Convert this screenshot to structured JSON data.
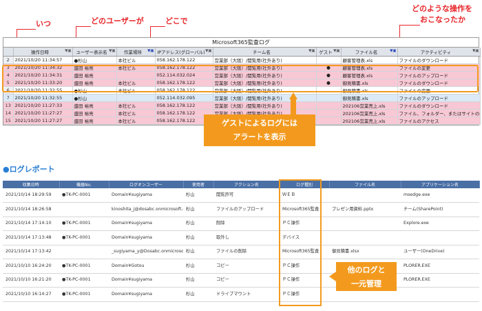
{
  "callouts": {
    "when": "いつ",
    "who": "どのユーザーが",
    "where": "どこで",
    "what_line1": "どのような操作を",
    "what_line2": "おこなったか"
  },
  "audit": {
    "title": "Microsoft365監査ログ",
    "columns": [
      "操作日時",
      "ユーザー表示名",
      "作業場所",
      "IPアドレス(グローバル)",
      "チーム名",
      "ゲスト",
      "ファイル名",
      "アクティビティ"
    ],
    "rows": [
      {
        "num": "2",
        "time": "2021/10/20 11:34:57",
        "user": "●杉山",
        "place": "本社ビル",
        "ip": "058.162.178.122",
        "team": "営業部（大阪）/閲覧用(社外あり)",
        "guest": "",
        "file": "顧客管理表.xls",
        "activity": "ファイルのダウンロード",
        "style": ""
      },
      {
        "num": "3",
        "time": "2021/10/20 11:34:32",
        "user": "盛田 裕亮",
        "place": "本社ビル",
        "ip": "058.162.178.122",
        "team": "営業部（大阪）/閲覧用(社外あり)",
        "guest": "●",
        "file": "顧客管理表.xls",
        "activity": "ファイルの変更",
        "style": "pink"
      },
      {
        "num": "4",
        "time": "2021/10/20 11:34:31",
        "user": "盛田 裕亮",
        "place": "",
        "ip": "052.114.032.024",
        "team": "営業部（大阪）/閲覧用(社外あり)",
        "guest": "●",
        "file": "顧客管理表.xls",
        "activity": "ファイルのアップロード",
        "style": "pink"
      },
      {
        "num": "5",
        "time": "2021/10/20 11:33:20",
        "user": "盛田 裕亮",
        "place": "本社ビル",
        "ip": "058.162.178.122",
        "team": "営業部（大阪）/閲覧用(社外あり)",
        "guest": "●",
        "file": "御見積書.xls",
        "activity": "ファイルのダウンロード",
        "style": "pink"
      },
      {
        "num": "6",
        "time": "2021/10/20 11:32:55",
        "user": "●杉山",
        "place": "本社ビル",
        "ip": "058.162.178.122",
        "team": "営業部（大阪）/閲覧用(社外あり)",
        "guest": "",
        "file": "御見積書.xls",
        "activity": "ファイルの変更",
        "style": ""
      },
      {
        "num": "7",
        "time": "2021/10/20 11:32:55",
        "user": "●杉山",
        "place": "",
        "ip": "052.114.032.095",
        "team": "営業部（大阪）/閲覧用(社外あり)",
        "guest": "",
        "file": "御見積書.xls",
        "activity": "ファイルのアップロード",
        "style": "blue"
      },
      {
        "num": "13",
        "time": "2021/10/20 11:27:33",
        "user": "盛田 裕亮",
        "place": "本社ビル",
        "ip": "058.162.178.122",
        "team": "営業部（大阪）/閲覧用(社外あり)",
        "guest": "",
        "file": "202106営業売上.xls",
        "activity": "ファイルのダウンロード",
        "style": "pink"
      },
      {
        "num": "14",
        "time": "2021/10/20 11:27:27",
        "user": "盛田 裕亮",
        "place": "本社ビル",
        "ip": "058.162.178.122",
        "team": "営業部（大阪）/閲覧用(社外あり)",
        "guest": "",
        "file": "202106営業売上.xls",
        "activity": "ファイル、フォルダー、またはサイトの共有",
        "style": "pink"
      },
      {
        "num": "15",
        "time": "2021/10/20 11:27:27",
        "user": "盛田 裕亮",
        "place": "本社ビル",
        "ip": "058.162.178.122",
        "team": "営業部（大阪）/閲覧用(社外あり)",
        "guest": "",
        "file": "202106営業売上.xls",
        "activity": "ファイルのアクセス",
        "style": "pink"
      }
    ]
  },
  "banner_guest": {
    "line1": "ゲストによるログには",
    "line2": "アラートを表示"
  },
  "section_title": "●ログレポート",
  "report": {
    "columns": [
      "収集日時",
      "機器No.",
      "ログオンユーザー",
      "使用者",
      "アクション名",
      "ログ種別",
      "ファイル名",
      "アプリケーション名"
    ],
    "rows": [
      {
        "time": "2021/10/14 18:29:59",
        "device": "●TK-PC-0001",
        "logon": "Domain¥sugiyama",
        "user": "杉山",
        "action": "閲覧許可",
        "type": "ＷＥＢ",
        "file": "",
        "app": "msedge.exe"
      },
      {
        "time": "2021/10/14 18:26:58",
        "device": "",
        "logon": "kinoshita_j@dosabc.onmicrosoft.com",
        "user": "杉山",
        "action": "ファイルのアップロード",
        "type": "Microsoft365監査",
        "file": "プレゼン用資料.pptx",
        "app": "チーム(SharePoint)"
      },
      {
        "time": "2021/10/14 17:14:10",
        "device": "●TK-PC-0001",
        "logon": "Domain¥sugiyama",
        "user": "杉山",
        "action": "削除",
        "type": "ＰＣ操作",
        "file": "",
        "app": "Explore.exe"
      },
      {
        "time": "2021/10/14 17:13:48",
        "device": "●TK-PC-0001",
        "logon": "Domain¥sugiyama",
        "user": "杉山",
        "action": "取外し",
        "type": "デバイス",
        "file": "",
        "app": ""
      },
      {
        "time": "2021/10/14 17:13:42",
        "device": "",
        "logon": "_sugiyama_y@Dosabc.onmicrosoft.com",
        "user": "杉山",
        "action": "ファイルの削除",
        "type": "Microsoft365監査",
        "file": "御見積書.xlsx",
        "app": "ユーザー(OneDrive)"
      },
      {
        "time": "2021/10/10 16:24:20",
        "device": "●TK-PC-0001",
        "logon": "Domain¥Gotou",
        "user": "杉山",
        "action": "コピー",
        "type": "ＰＣ操作",
        "file": "",
        "app": "PLORER.EXE"
      },
      {
        "time": "2021/10/10 16:21:20",
        "device": "●TK-PC-0001",
        "logon": "Domain¥sugiyama",
        "user": "杉山",
        "action": "コピー",
        "type": "ＰＣ操作",
        "file": "",
        "app": "PLORER.EXE"
      },
      {
        "time": "2021/10/10 16:14:27",
        "device": "●TK-PC-0001",
        "logon": "Domain¥sugiyama",
        "user": "杉山",
        "action": "ドライブマウント",
        "type": "ＰＣ操作",
        "file": "",
        "app": ""
      }
    ]
  },
  "banner_unified": {
    "line1": "他のログと",
    "line2": "一元管理"
  },
  "colors": {
    "accent_red": "#e8262a",
    "accent_orange": "#f39a1e",
    "pink_row": "#f8c8d4",
    "blue_row": "#dce9f7",
    "report_header": "#4a6fa5",
    "section_blue": "#2a7fd4"
  }
}
